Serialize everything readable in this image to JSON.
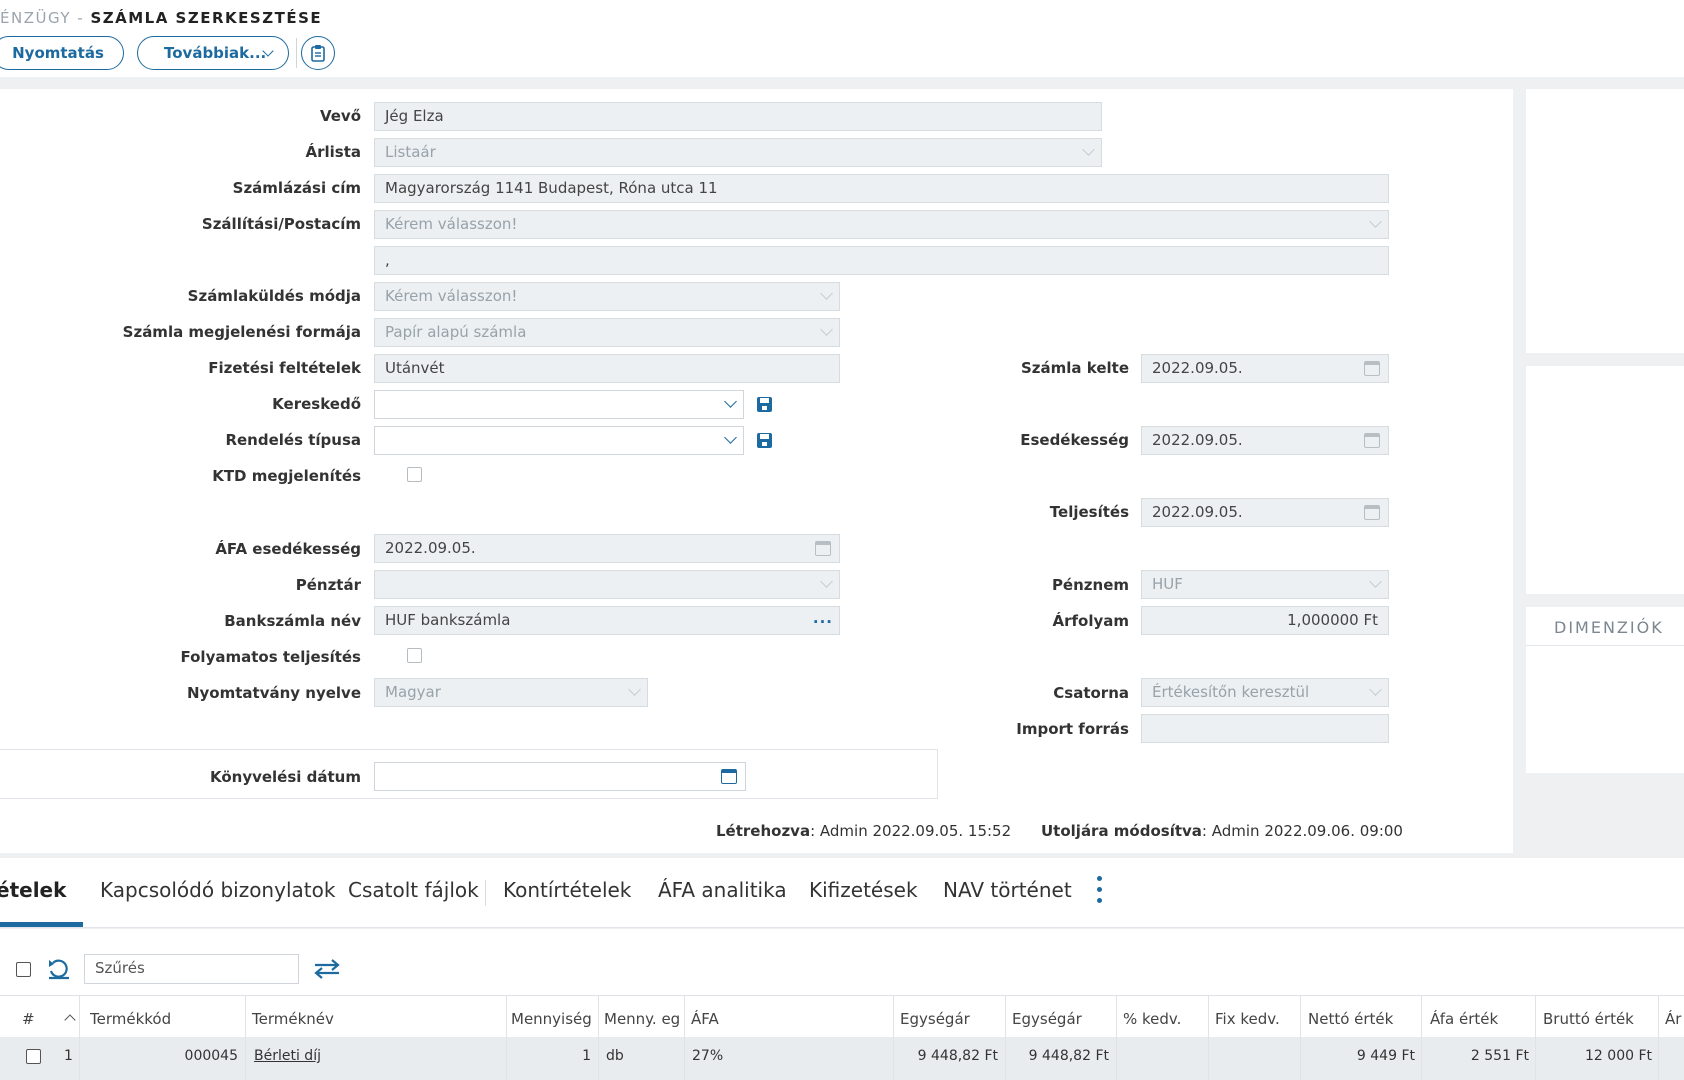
{
  "header": {
    "module": "ÉNZÜGY - ",
    "title": "SZÁMLA SZERKESZTÉSE",
    "print_button": "Nyomtatás",
    "more_button": "Továbbiak..."
  },
  "form": {
    "customer": {
      "label": "Vevő",
      "value": "Jég Elza"
    },
    "price_list": {
      "label": "Árlista",
      "value": "Listaár"
    },
    "billing_address": {
      "label": "Számlázási cím",
      "value": "Magyarország 1141 Budapest, Róna utca 11"
    },
    "shipping_address": {
      "label": "Szállítási/Postacím",
      "value": "Kérem válasszon!",
      "second_line": " ,"
    },
    "send_method": {
      "label": "Számlaküldés módja",
      "value": "Kérem válasszon!"
    },
    "invoice_format": {
      "label": "Számla megjelenési formája",
      "value": "Papír alapú számla"
    },
    "payment_terms": {
      "label": "Fizetési feltételek",
      "value": "Utánvét"
    },
    "merchant": {
      "label": "Kereskedő",
      "value": ""
    },
    "order_type": {
      "label": "Rendelés típusa",
      "value": ""
    },
    "ktd_display": {
      "label": "KTD megjelenítés"
    },
    "vat_due": {
      "label": "ÁFA esedékesség",
      "value": "2022.09.05."
    },
    "cash_register": {
      "label": "Pénztár",
      "value": ""
    },
    "bank_account": {
      "label": "Bankszámla név",
      "value": "HUF bankszámla",
      "more": "..."
    },
    "continuous": {
      "label": "Folyamatos teljesítés"
    },
    "print_language": {
      "label": "Nyomtatvány nyelve",
      "value": "Magyar"
    },
    "invoice_date": {
      "label": "Számla kelte",
      "value": "2022.09.05."
    },
    "due_date": {
      "label": "Esedékesség",
      "value": "2022.09.05."
    },
    "fulfillment": {
      "label": "Teljesítés",
      "value": "2022.09.05."
    },
    "currency": {
      "label": "Pénznem",
      "value": "HUF"
    },
    "exchange_rate": {
      "label": "Árfolyam",
      "value": "1,000000 Ft"
    },
    "channel": {
      "label": "Csatorna",
      "value": "Értékesítőn keresztül"
    },
    "import_source": {
      "label": "Import forrás",
      "value": ""
    },
    "posting_date": {
      "label": "Könyvelési dátum",
      "value": ""
    }
  },
  "meta": {
    "created_label": "Létrehozva",
    "created_value": ": Admin 2022.09.05. 15:52",
    "modified_label": "Utoljára módosítva",
    "modified_value": ": Admin 2022.09.06. 09:00"
  },
  "side": {
    "dimensions_title": "DIMENZIÓK"
  },
  "tabs": [
    "ételek",
    "Kapcsolódó bizonylatok",
    "Csatolt fájlok",
    "Kontírtételek",
    "ÁFA analitika",
    "Kifizetések",
    "NAV történet"
  ],
  "table": {
    "filter_placeholder": "Szűrés",
    "columns": [
      "#",
      "Termékkód",
      "Terméknév",
      "Mennyiség",
      "Menny. eg",
      "ÁFA",
      "Egységár",
      "Egységár",
      "% kedv.",
      "Fix kedv.",
      "Nettó érték",
      "Áfa érték",
      "Bruttó érték",
      "Ár"
    ],
    "rows": [
      {
        "num": "1",
        "code": "000045",
        "name": "Bérleti díj",
        "qty": "1",
        "unit": "db",
        "vat": "27%",
        "unit_price": "9 448,82 Ft",
        "unit_price2": "9 448,82 Ft",
        "pct_disc": "",
        "fix_disc": "",
        "net": "9 449 Ft",
        "vat_value": "2 551 Ft",
        "gross": "12 000 Ft"
      }
    ]
  },
  "colors": {
    "accent": "#1c6aa0",
    "field_bg": "#edf0f2"
  }
}
